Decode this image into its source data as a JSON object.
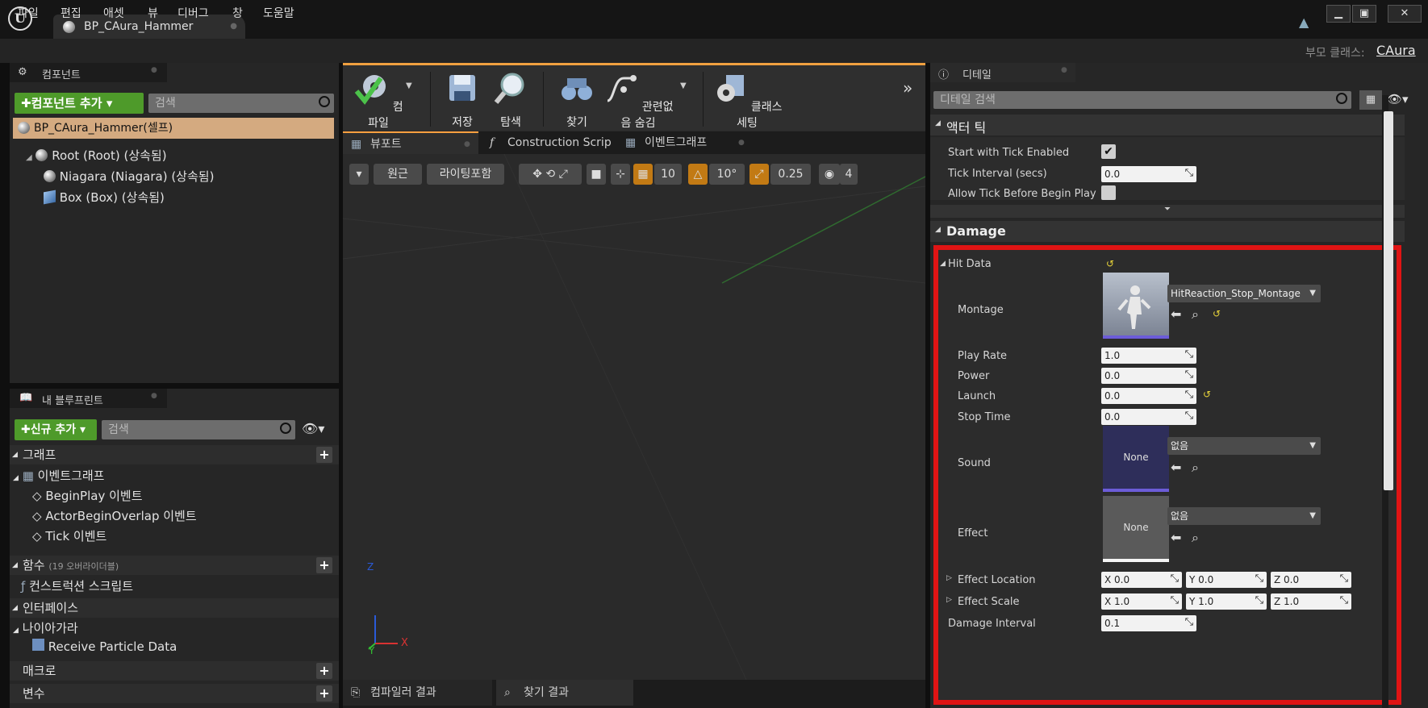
{
  "window": {
    "tab_title": "BP_CAura_Hammer",
    "parent_class_label": "부모 클래스:",
    "parent_class_value": "CAura"
  },
  "menu": [
    "파일",
    "편집",
    "애셋",
    "뷰",
    "디버그",
    "창",
    "도움말"
  ],
  "components_panel": {
    "title": "컴포넌트",
    "add_button": "✚컴포넌트 추가 ▾",
    "search_placeholder": "검색",
    "self_item": "BP_CAura_Hammer(셀프)",
    "tree": [
      {
        "label": "Root (Root) (상속됨)",
        "icon": "sphere-icon"
      },
      {
        "label": "Niagara (Niagara) (상속됨)",
        "icon": "niagara-icon"
      },
      {
        "label": "Box (Box) (상속됨)",
        "icon": "box-icon"
      }
    ]
  },
  "my_blueprint": {
    "title": "내 블루프린트",
    "new_button": "✚신규 추가 ▾",
    "search_placeholder": "검색",
    "sections": {
      "graph": "그래프",
      "event_graph": "이벤트그래프",
      "events": [
        "BeginPlay 이벤트",
        "ActorBeginOverlap 이벤트",
        "Tick 이벤트"
      ],
      "functions": "함수",
      "functions_note": "(19 오버라이더블)",
      "construction_script": "컨스트럭션 스크립트",
      "interfaces": "인터페이스",
      "niagara": "나이아가라",
      "receive_particle": "Receive Particle Data",
      "macros": "매크로",
      "variables": "변수"
    }
  },
  "toolbar": {
    "compile": "컴파일",
    "save": "저장",
    "browse": "탐색",
    "find": "찾기",
    "hide_unrelated": "관련없음 숨김",
    "class_settings": "클래스 세팅"
  },
  "viewport": {
    "tabs": [
      "뷰포트",
      "Construction Scrip",
      "이벤트그래프"
    ],
    "perspective": "원근",
    "lit": "라이팅포함",
    "grid_snap": "10",
    "rot_snap": "10°",
    "scale_snap": "0.25",
    "cam_speed": "4",
    "axis_x": "X",
    "axis_y": "Y",
    "axis_z": "Z",
    "bottom_tabs": [
      "컴파일러 결과",
      "찾기 결과"
    ]
  },
  "details": {
    "title": "디테일",
    "search_placeholder": "디테일 검색",
    "actor_tick": {
      "header": "액터 틱",
      "start_with_tick": "Start with Tick Enabled",
      "start_with_tick_value": true,
      "tick_interval": "Tick Interval (secs)",
      "tick_interval_value": "0.0",
      "allow_tick": "Allow Tick Before Begin Play",
      "allow_tick_value": false
    },
    "damage": {
      "header": "Damage",
      "hit_data": "Hit Data",
      "montage": "Montage",
      "montage_value": "HitReaction_Stop_Montage",
      "play_rate": "Play Rate",
      "play_rate_value": "1.0",
      "power": "Power",
      "power_value": "0.0",
      "launch": "Launch",
      "launch_value": "0.0",
      "stop_time": "Stop Time",
      "stop_time_value": "0.0",
      "sound": "Sound",
      "sound_thumb": "None",
      "sound_value": "없음",
      "effect": "Effect",
      "effect_thumb": "None",
      "effect_value": "없음",
      "effect_location": "Effect Location",
      "effect_location_x": "X  0.0",
      "effect_location_y": "Y  0.0",
      "effect_location_z": "Z  0.0",
      "effect_scale": "Effect Scale",
      "effect_scale_x": "X  1.0",
      "effect_scale_y": "Y  1.0",
      "effect_scale_z": "Z  1.0",
      "damage_interval": "Damage Interval",
      "damage_interval_value": "0.1"
    }
  },
  "colors": {
    "highlight_border": "#e01414",
    "compile_green": "#4e9a2a",
    "accent_orange": "#c27a14"
  }
}
